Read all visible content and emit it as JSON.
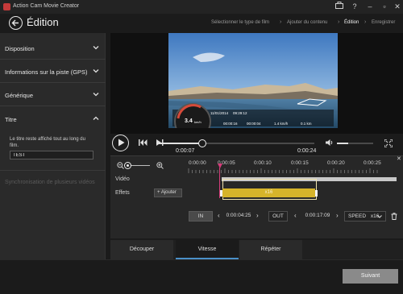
{
  "window": {
    "title": "Action Cam Movie Creator"
  },
  "header": {
    "title": "Édition",
    "breadcrumbs": [
      "Sélectionner le type de film",
      "Ajouter du contenu",
      "Édition",
      "Enregistrer"
    ]
  },
  "sidebar": {
    "items": [
      {
        "label": "Disposition",
        "expanded": false
      },
      {
        "label": "Informations sur la piste (GPS)",
        "expanded": false
      },
      {
        "label": "Générique",
        "expanded": false
      },
      {
        "label": "Titre",
        "expanded": true
      }
    ],
    "titre": {
      "description": "Le titre reste affiché tout au long du film.",
      "value": "TEST"
    },
    "sync_label": "Synchronisation de plusieurs vidéos"
  },
  "video_overlay": {
    "speed_value": "3.4",
    "speed_unit": "km/h",
    "date": "11/01/2014",
    "time": "09:29:12",
    "stats": [
      "00:00:16",
      "00:00:04",
      "1.4 km/h",
      "0.1 km"
    ]
  },
  "playback": {
    "current_time": "0:00:07",
    "total_time": "0:00:24",
    "progress": 0.29,
    "volume": 0.3
  },
  "timeline": {
    "ticks": [
      "0:00:00",
      "0:00:05",
      "0:00:10",
      "0:00:15",
      "0:00:20",
      "0:00:25"
    ],
    "video_label": "Vidéo",
    "effects_label": "Effets",
    "add_label": "+ Ajouter",
    "effect_name": "x16",
    "in_label": "IN",
    "in_time": "0:00:04:25",
    "out_label": "OUT",
    "out_time": "0:00:17:09",
    "speed_label": "SPEED",
    "speed_value": "x16"
  },
  "tabs": [
    {
      "label": "Découper",
      "active": false
    },
    {
      "label": "Vitesse",
      "active": true
    },
    {
      "label": "Répéter",
      "active": false
    }
  ],
  "footer": {
    "next_label": "Suivant"
  },
  "colors": {
    "accent": "#d63d7a",
    "effect": "#d6b42a",
    "tab_active": "#4a90c8"
  }
}
